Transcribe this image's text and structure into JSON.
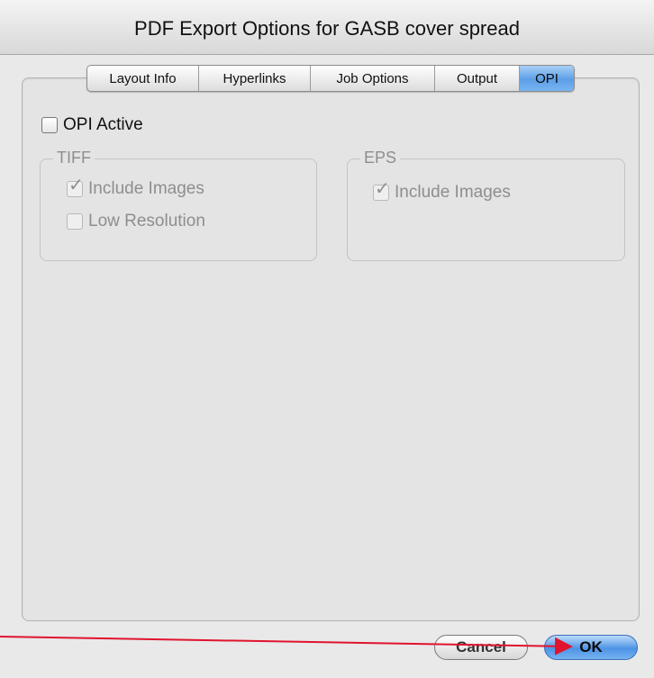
{
  "window": {
    "title": "PDF Export Options for GASB cover spread"
  },
  "tabs": [
    {
      "label": "Layout Info",
      "active": false
    },
    {
      "label": "Hyperlinks",
      "active": false
    },
    {
      "label": "Job Options",
      "active": false
    },
    {
      "label": "Output",
      "active": false
    },
    {
      "label": "OPI",
      "active": true
    }
  ],
  "opi": {
    "active_label": "OPI Active",
    "active_checked": false,
    "tiff": {
      "legend": "TIFF",
      "include_images_label": "Include Images",
      "include_images_checked": true,
      "low_resolution_label": "Low Resolution",
      "low_resolution_checked": false
    },
    "eps": {
      "legend": "EPS",
      "include_images_label": "Include Images",
      "include_images_checked": true
    }
  },
  "buttons": {
    "cancel_label": "Cancel",
    "ok_label": "OK"
  },
  "annotation": {
    "arrow_color": "#e0142e"
  }
}
